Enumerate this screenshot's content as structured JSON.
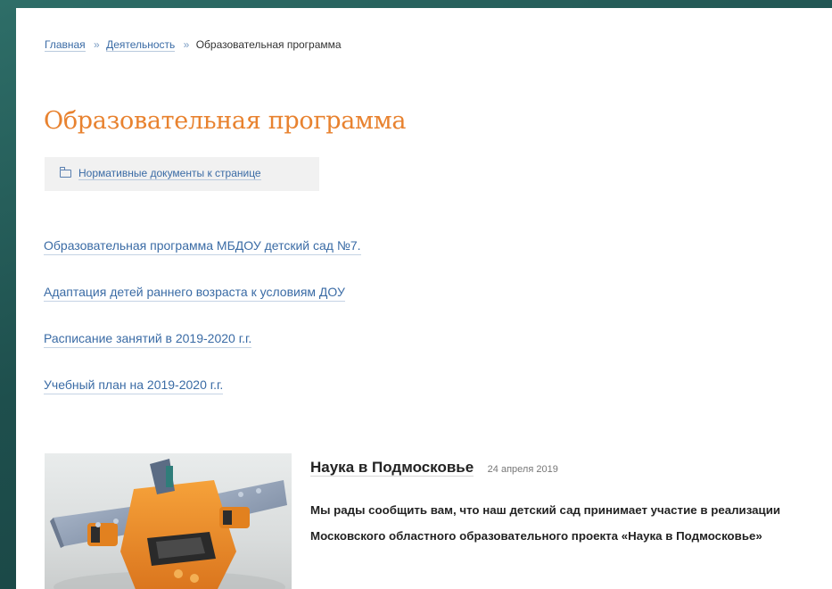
{
  "breadcrumb": {
    "items": [
      {
        "label": "Главная"
      },
      {
        "label": "Деятельность"
      }
    ],
    "separator": "»",
    "current": "Образовательная программа"
  },
  "page": {
    "title": "Образовательная программа",
    "docs_link": "Нормативные документы к странице",
    "docs_icon": "folder-icon"
  },
  "links": [
    {
      "label": "Образовательная программа МБДОУ детский сад №7."
    },
    {
      "label": "Адаптация детей раннего возраста к условиям ДОУ"
    },
    {
      "label": "Расписание занятий в 2019-2020 г.г."
    },
    {
      "label": "Учебный план на 2019-2020 г.г."
    }
  ],
  "news": {
    "title": "Наука в Подмосковье",
    "date": "24 апреля 2019",
    "text": "Мы рады сообщить вам, что наш детский сад принимает участие в реализации Московского областного образовательного проекта «Наука в Подмосковье»"
  },
  "colors": {
    "accent_title": "#e8822f",
    "link": "#3a6ba5",
    "background": "#1e4f4d"
  }
}
